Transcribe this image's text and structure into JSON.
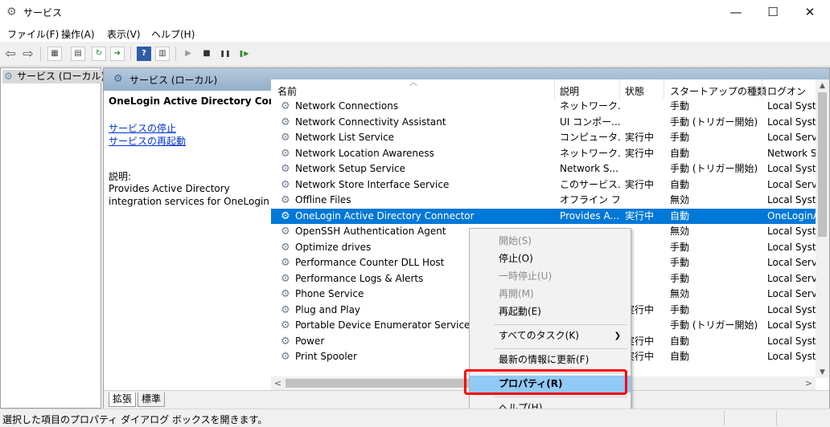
{
  "window": {
    "title": "サービス",
    "minimize": "—",
    "maximize": "☐",
    "close": "✕"
  },
  "menu": [
    "ファイル(F)",
    "操作(A)",
    "表示(V)",
    "ヘルプ(H)"
  ],
  "toolbar": {
    "back": "⇦",
    "forward": "⇨",
    "play": "▶",
    "stop": "■",
    "pause": "❚❚",
    "resume": "❚▶"
  },
  "tree": {
    "root": "サービス (ローカル)"
  },
  "panel": {
    "title": "サービス (ローカル)"
  },
  "details": {
    "service_name": "OneLogin Active Directory Connector",
    "stop_link": "サービスの停止",
    "restart_link": "サービスの再起動",
    "desc_label": "説明:",
    "desc_text": "Provides Active Directory integration services for OneLogin"
  },
  "columns": {
    "name": "名前",
    "desc": "説明",
    "status": "状態",
    "startup": "スタートアップの種類",
    "logon": "ログオン"
  },
  "services": [
    {
      "name": "Network Connections",
      "desc": "ネットワーク...",
      "status": "",
      "startup": "手動",
      "logon": "Local Syste"
    },
    {
      "name": "Network Connectivity Assistant",
      "desc": "UI コンポー...",
      "status": "",
      "startup": "手動 (トリガー開始)",
      "logon": "Local Syste"
    },
    {
      "name": "Network List Service",
      "desc": "コンピュータ...",
      "status": "実行中",
      "startup": "手動",
      "logon": "Local Servi"
    },
    {
      "name": "Network Location Awareness",
      "desc": "ネットワーク...",
      "status": "実行中",
      "startup": "自動",
      "logon": "Network Se"
    },
    {
      "name": "Network Setup Service",
      "desc": "Network S...",
      "status": "",
      "startup": "手動 (トリガー開始)",
      "logon": "Local Syste"
    },
    {
      "name": "Network Store Interface Service",
      "desc": "このサービス...",
      "status": "実行中",
      "startup": "自動",
      "logon": "Local Servi"
    },
    {
      "name": "Offline Files",
      "desc": "オフライン フ...",
      "status": "",
      "startup": "無効",
      "logon": "Local Syste"
    },
    {
      "name": "OneLogin Active Directory Connector",
      "desc": "Provides A...",
      "status": "実行中",
      "startup": "自動",
      "logon": "OneLoginA"
    },
    {
      "name": "OpenSSH Authentication Agent",
      "desc": "",
      "status": "",
      "startup": "無効",
      "logon": "Local Syste"
    },
    {
      "name": "Optimize drives",
      "desc": "",
      "status": "",
      "startup": "手動",
      "logon": "Local Syste"
    },
    {
      "name": "Performance Counter DLL Host",
      "desc": "",
      "status": "",
      "startup": "手動",
      "logon": "Local Servi"
    },
    {
      "name": "Performance Logs & Alerts",
      "desc": "",
      "status": "",
      "startup": "手動",
      "logon": "Local Servi"
    },
    {
      "name": "Phone Service",
      "desc": "",
      "status": "",
      "startup": "無効",
      "logon": "Local Servi"
    },
    {
      "name": "Plug and Play",
      "desc": "",
      "status": "実行中",
      "startup": "手動",
      "logon": "Local Syste"
    },
    {
      "name": "Portable Device Enumerator Service",
      "desc": "",
      "status": "",
      "startup": "手動 (トリガー開始)",
      "logon": "Local Syste"
    },
    {
      "name": "Power",
      "desc": "",
      "status": "実行中",
      "startup": "自動",
      "logon": "Local Syste"
    },
    {
      "name": "Print Spooler",
      "desc": "",
      "status": "実行中",
      "startup": "自動",
      "logon": "Local Syste"
    }
  ],
  "context_menu": {
    "start": "開始(S)",
    "stop": "停止(O)",
    "pause": "一時停止(U)",
    "resume": "再開(M)",
    "restart": "再起動(E)",
    "all_tasks": "すべてのタスク(K)",
    "refresh": "最新の情報に更新(F)",
    "properties": "プロパティ(R)",
    "help": "ヘルプ(H)"
  },
  "tabs": {
    "extended": "拡張",
    "standard": "標準"
  },
  "status": "選択した項目のプロパティ ダイアログ ボックスを開きます。"
}
